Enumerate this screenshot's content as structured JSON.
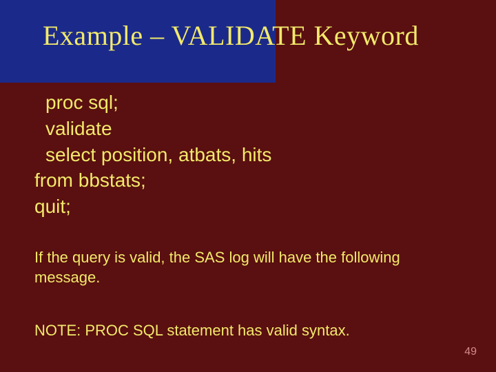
{
  "title": "Example – VALIDATE Keyword",
  "code": {
    "l1": "proc sql;",
    "l2": "validate",
    "l3": "select position, atbats, hits",
    "l4": "from bbstats;",
    "l5": "quit;"
  },
  "explain": "If the query is valid, the SAS log will have the following message.",
  "note": "NOTE:  PROC SQL statement has valid syntax.",
  "page": "49"
}
